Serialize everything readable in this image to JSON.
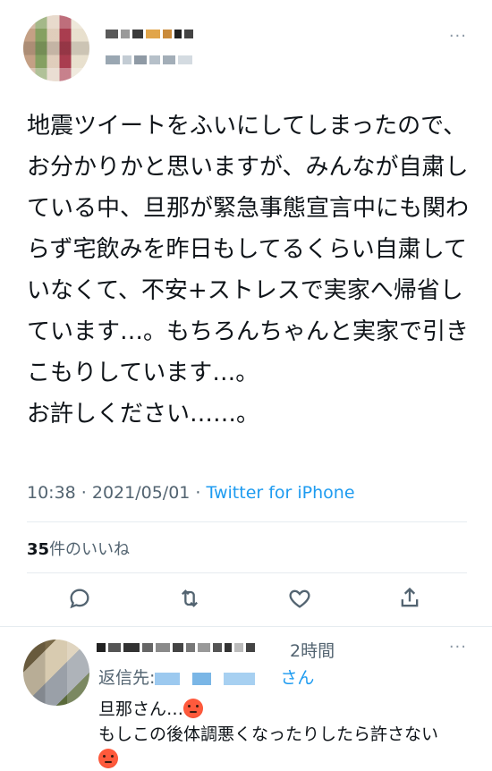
{
  "tweet": {
    "body": "地震ツイートをふいにしてしまったので、お分かりかと思いますが、みんなが自粛している中、旦那が緊急事態宣言中にも関わらず宅飲みを昨日もしてるくらい自粛していなくて、不安+ストレスで実家へ帰省しています…。もちろんちゃんと実家で引きこもりしています…。\nお許しください……。",
    "time": "10:38 · 2021/05/01 · ",
    "source": "Twitter for iPhone",
    "likes_count": "35",
    "likes_label": "件のいいね",
    "more": "···",
    "actions": [
      "reply-icon",
      "retweet-icon",
      "like-icon",
      "share-icon"
    ]
  },
  "reply": {
    "time": "2時間",
    "reply_to_prefix": "返信先:",
    "reply_to_suffix": "さん",
    "line1": "旦那さん…",
    "line2": "もしこの後体調悪くなったりしたら許さない",
    "more": "···"
  },
  "colors": {
    "link": "#1d9bf0",
    "muted": "#536471",
    "text": "#0f1419",
    "divider": "#e6ecf0"
  }
}
